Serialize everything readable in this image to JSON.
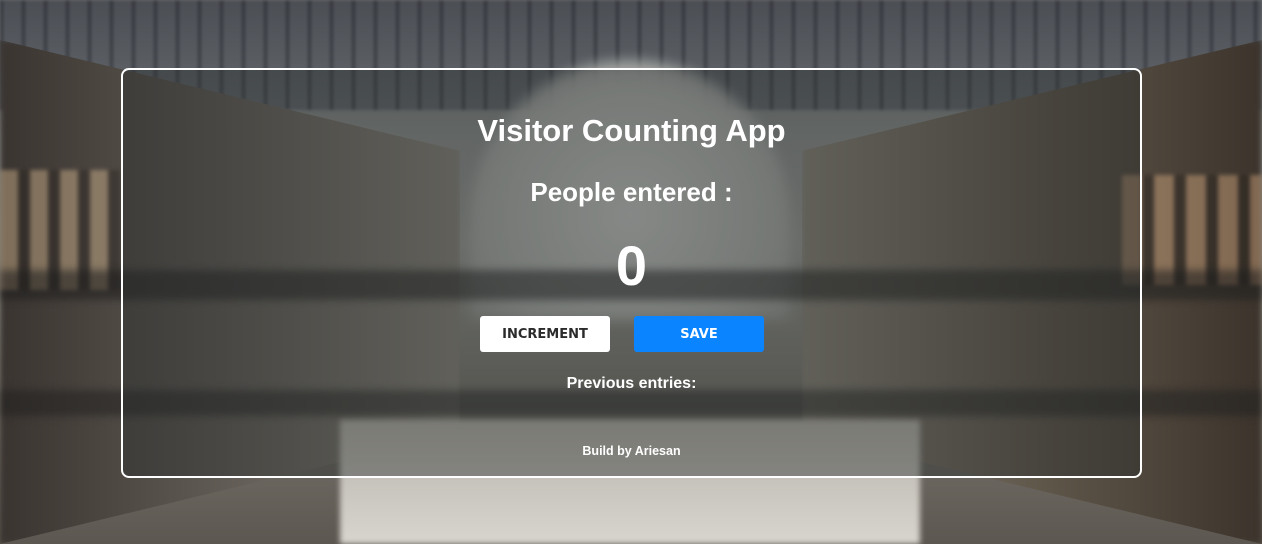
{
  "app": {
    "title": "Visitor Counting App",
    "subtitle": "People entered :",
    "count": "0"
  },
  "actions": {
    "increment_label": "INCREMENT",
    "save_label": "SAVE"
  },
  "history": {
    "heading": "Previous entries:",
    "entries": []
  },
  "footer": {
    "credit": "Build by Ariesan"
  },
  "colors": {
    "save_button": "#0a84ff",
    "increment_button": "#ffffff",
    "card_border": "#ffffff",
    "text": "#ffffff"
  }
}
